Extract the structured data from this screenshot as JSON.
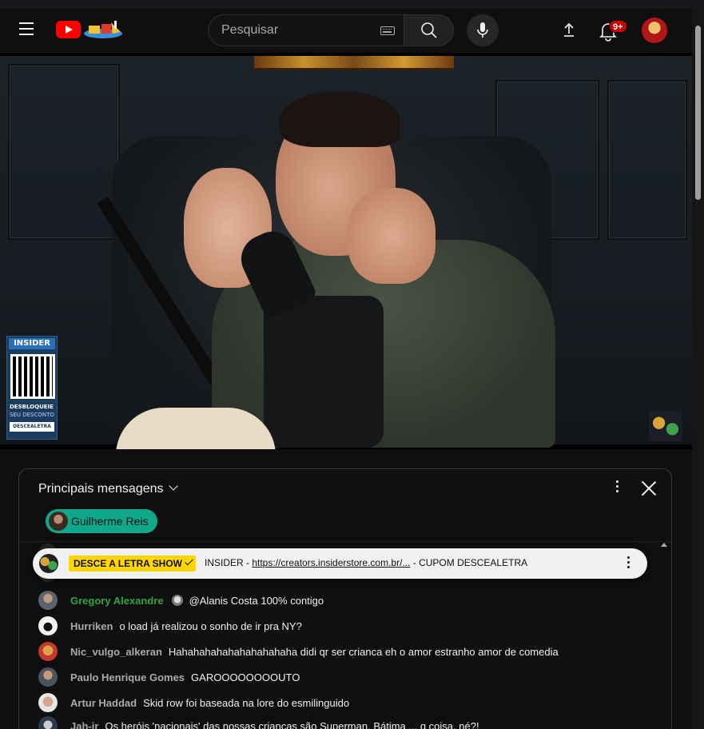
{
  "header": {
    "search_placeholder": "Pesquisar",
    "notifications_count": "9+",
    "icons": [
      "menu-icon",
      "youtube-logo",
      "keyboard-icon",
      "search-icon",
      "microphone-icon",
      "upload-icon",
      "bell-icon"
    ]
  },
  "video_overlay": {
    "sponsor_title": "INSIDER",
    "sponsor_line1": "DESBLOQUEIE",
    "sponsor_line2": "SEU DESCONTO",
    "sponsor_code": "DESCEALETRA"
  },
  "chat": {
    "title": "Principais mensagens",
    "member_chip": "Guilherme Reis",
    "pinned": {
      "label": "DESCE A LETRA SHOW",
      "prefix": "INSIDER - ",
      "link": "https://creators.insiderstore.com.br/...",
      "suffix": " - CUPOM DESCEALETRA"
    },
    "messages": [
      {
        "author": "Gregory Alexandre",
        "text": "@Alanis Costa 100% contigo",
        "color": "#2ba640"
      },
      {
        "author": "Hurriken",
        "text": "o load já realizou o sonho de ir pra NY?"
      },
      {
        "author": "Nic_vulgo_alkeran",
        "text": "Hahahahahahahahahahaha didi qr ser crianca eh o amor estranho amor de comedia"
      },
      {
        "author": "Paulo Henrique Gomes",
        "text": "GAROOOOOOOOUTO"
      },
      {
        "author": "Artur Haddad",
        "text": "Skid row foi baseada na lore do esmilinguido"
      },
      {
        "author": "Jah-ir",
        "text": "Os heróis 'nacionais' das nossas crianças são Superman, Bátima ... q coisa, né?!"
      }
    ]
  },
  "colors": {
    "accent_red": "#ff0000",
    "member_chip": "#0fa88b",
    "pinned_label": "#ffd600",
    "member_name": "#2ba640"
  }
}
